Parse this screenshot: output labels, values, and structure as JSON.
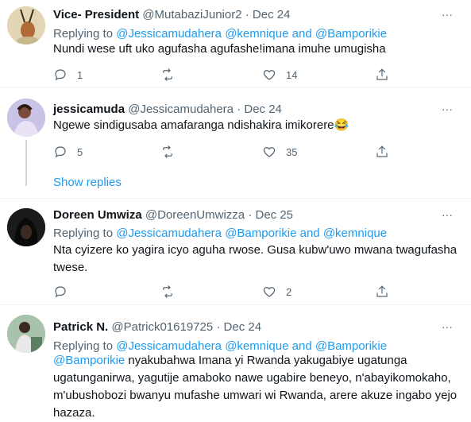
{
  "tweets": [
    {
      "name": "Vice- President",
      "handle": "@MutabaziJunior2",
      "date": "Dec 24",
      "replying_prefix": "Replying to",
      "mentions": [
        "@Jessicamudahera",
        "@kemnique",
        "@Bamporikie"
      ],
      "joiner": "and",
      "text": "Nundi wese uft uko agufasha agufashe!imana imuhe umugisha",
      "replies": "1",
      "retweets": "",
      "likes": "14"
    },
    {
      "name": "jessicamuda",
      "handle": "@Jessicamudahera",
      "date": "Dec 24",
      "text": "Ngewe sindigusaba amafaranga ndishakira imikorere😂",
      "replies": "5",
      "retweets": "",
      "likes": "35",
      "show_replies": "Show replies"
    },
    {
      "name": "Doreen Umwiza",
      "handle": "@DoreenUmwizza",
      "date": "Dec 25",
      "replying_prefix": "Replying to",
      "mentions": [
        "@Jessicamudahera",
        "@Bamporikie",
        "@kemnique"
      ],
      "joiner": "and",
      "text": "Nta cyizere ko yagira icyo aguha rwose. Gusa kubw'uwo mwana twagufasha twese.",
      "replies": "",
      "retweets": "",
      "likes": "2"
    },
    {
      "name": "Patrick N.",
      "handle": "@Patrick01619725",
      "date": "Dec 24",
      "replying_prefix": "Replying to",
      "mentions": [
        "@Jessicamudahera",
        "@kemnique",
        "@Bamporikie"
      ],
      "joiner": "and",
      "text_mention": "@Bamporikie",
      "text": " nyakubahwa Imana yi Rwanda yakugabiye ugatunga ugatunganirwa, yagutije amaboko nawe ugabire beneyo, n'abayikomokaho, m'ubushobozi bwanyu mufashe umwari wi Rwanda, arere akuze ingabo yejo hazaza."
    }
  ],
  "icons": [
    "reply-icon",
    "retweet-icon",
    "like-icon",
    "share-icon",
    "more-icon"
  ],
  "colors": {
    "accent": "#1d9bf0",
    "secondary_text": "#536471",
    "divider": "#eff3f4"
  },
  "more_glyph": "···",
  "separator": "·"
}
